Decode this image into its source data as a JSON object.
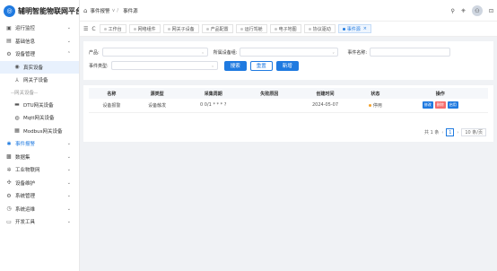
{
  "app": {
    "title": "辅明智能物联网平台",
    "logo_char": "◎"
  },
  "sidebar": {
    "items": [
      {
        "label": "运行监控",
        "icon": "monitor-icon",
        "glyph": "▣",
        "chevron": "⌄"
      },
      {
        "label": "基础信息",
        "icon": "info-icon",
        "glyph": "▤",
        "chevron": "⌄"
      },
      {
        "label": "设备管理",
        "icon": "device-icon",
        "glyph": "⚙",
        "chevron": "⌃"
      },
      {
        "label": "真实设备",
        "icon": "real-device-icon",
        "glyph": "◉",
        "sub": true
      },
      {
        "label": "网关子设备",
        "icon": "gateway-child-icon",
        "glyph": "⅄",
        "sub": true
      },
      {
        "label": "--网关设备--",
        "group": true
      },
      {
        "label": "DTU网关设备",
        "icon": "dtu-icon",
        "glyph": "▬",
        "sub": true
      },
      {
        "label": "Mqtt网关设备",
        "icon": "mqtt-icon",
        "glyph": "◍",
        "sub": true
      },
      {
        "label": "Modbus网关设备",
        "icon": "modbus-icon",
        "glyph": "▦",
        "sub": true
      },
      {
        "label": "事件报警",
        "icon": "alarm-icon",
        "glyph": "✱",
        "chevron": "⌄",
        "highlight": true
      },
      {
        "label": "数据集",
        "icon": "dataset-icon",
        "glyph": "▩",
        "chevron": "⌄"
      },
      {
        "label": "工业物联网",
        "icon": "industry-icon",
        "glyph": "✲",
        "chevron": "⌄"
      },
      {
        "label": "设备维护",
        "icon": "maintain-icon",
        "glyph": "✣",
        "chevron": "⌄"
      },
      {
        "label": "系统管理",
        "icon": "system-icon",
        "glyph": "⚙",
        "chevron": "⌄"
      },
      {
        "label": "系统运维",
        "icon": "ops-icon",
        "glyph": "◷",
        "chevron": "⌄"
      },
      {
        "label": "开发工具",
        "icon": "devtool-icon",
        "glyph": "▭",
        "chevron": "⌄"
      }
    ]
  },
  "topbar": {
    "breadcrumb": [
      "事件报警",
      "事件源"
    ],
    "home_glyph": "⌂",
    "sep": "∨ /",
    "right_icons": [
      "⚲",
      "⁜",
      "⚇",
      "⊡"
    ]
  },
  "tabs": {
    "controls": [
      "☰",
      "C"
    ],
    "items": [
      {
        "label": "工作台"
      },
      {
        "label": "网络组件"
      },
      {
        "label": "网关子设备"
      },
      {
        "label": "产品配置"
      },
      {
        "label": "运行驾舱"
      },
      {
        "label": "电子地图"
      },
      {
        "label": "协议驱动"
      },
      {
        "label": "事件源",
        "active": true,
        "close": "×"
      }
    ]
  },
  "filters": {
    "product_label": "产品:",
    "device_label": "所属设备组:",
    "event_name_label": "事件名称:",
    "event_type_label": "事件类型:",
    "search_btn": "搜索",
    "reset_btn": "重置",
    "add_btn": "新增"
  },
  "table": {
    "columns": [
      "名称",
      "源类型",
      "采集周期",
      "失败原因",
      "创建时间",
      "状态",
      "操作"
    ],
    "rows": [
      {
        "name": "设备报警",
        "source": "设备触发",
        "cycle": "0 0/1 * * * ?",
        "fail": "",
        "created": "2024-05-07",
        "status": "停用",
        "ops": [
          "修改",
          "删除",
          "启用"
        ]
      }
    ]
  },
  "pager": {
    "total": "共 1 条",
    "prev": "‹",
    "page": "1",
    "next": "›",
    "size": "10 条/页"
  },
  "colors": {
    "accent": "#1f7ae0",
    "danger": "#f56c6c",
    "warning": "#f4a12b"
  }
}
